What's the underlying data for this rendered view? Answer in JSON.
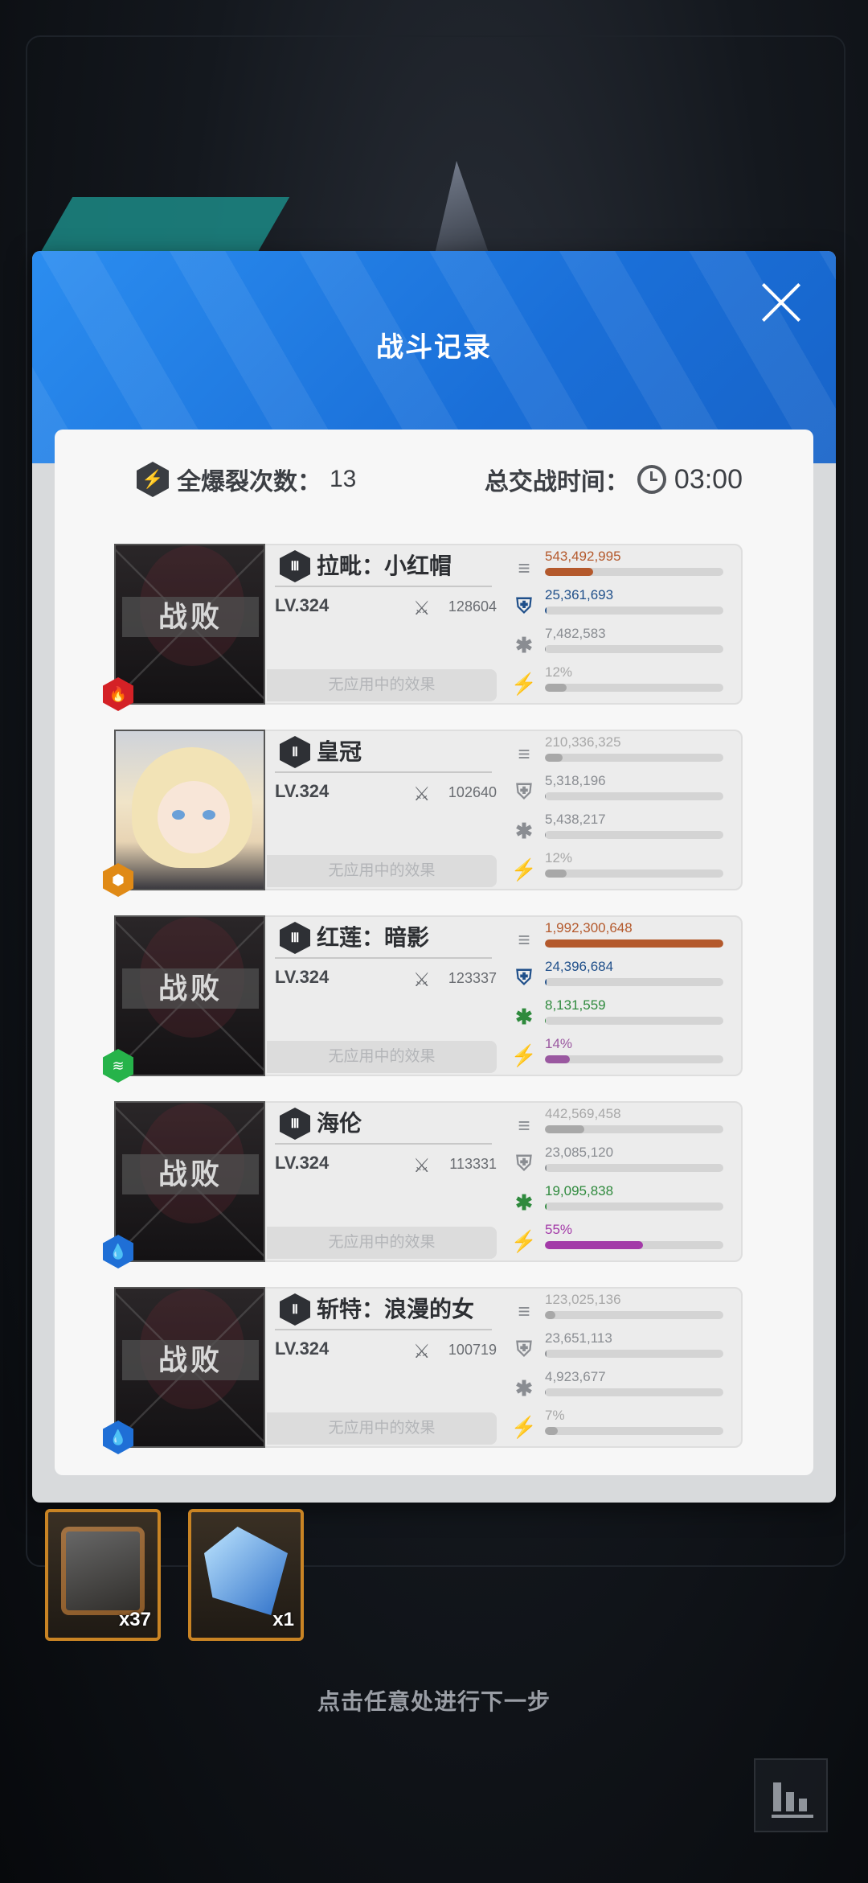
{
  "dialog": {
    "title": "战斗记录",
    "summary": {
      "burst_label": "全爆裂次数：",
      "burst_count": "13",
      "time_label": "总交战时间：",
      "time_value": "03:00"
    }
  },
  "rows": [
    {
      "rank": "Ⅲ",
      "name": "拉毗：小红帽",
      "level": "LV.324",
      "power": "128604",
      "status": "战败",
      "element": "fire-icon",
      "effect": "无应用中的效果",
      "stats": [
        {
          "value": "543,492,995",
          "fraction": 0.27,
          "color": "#b4592c"
        },
        {
          "value": "25,361,693",
          "fraction": 0.01,
          "color": "#1f4f8a"
        },
        {
          "value": "7,482,583",
          "fraction": 0.0,
          "color": "#8a8d92"
        },
        {
          "value": "12%",
          "fraction": 0.12,
          "color": "#a8a8a8"
        }
      ]
    },
    {
      "rank": "Ⅱ",
      "name": "皇冠",
      "level": "LV.324",
      "power": "102640",
      "status": "",
      "element": "iron-icon",
      "effect": "无应用中的效果",
      "stats": [
        {
          "value": "210,336,325",
          "fraction": 0.1,
          "color": "#a8a8a8"
        },
        {
          "value": "5,318,196",
          "fraction": 0.0,
          "color": "#8a8d92"
        },
        {
          "value": "5,438,217",
          "fraction": 0.0,
          "color": "#8a8d92"
        },
        {
          "value": "12%",
          "fraction": 0.12,
          "color": "#a8a8a8"
        }
      ]
    },
    {
      "rank": "Ⅲ",
      "name": "红莲：暗影",
      "level": "LV.324",
      "power": "123337",
      "status": "战败",
      "element": "wind-icon",
      "effect": "无应用中的效果",
      "stats": [
        {
          "value": "1,992,300,648",
          "fraction": 1.0,
          "color": "#b4592c"
        },
        {
          "value": "24,396,684",
          "fraction": 0.01,
          "color": "#1f4f8a"
        },
        {
          "value": "8,131,559",
          "fraction": 0.0,
          "color": "#2f8a3d"
        },
        {
          "value": "14%",
          "fraction": 0.14,
          "color": "#9a58a0"
        }
      ]
    },
    {
      "rank": "Ⅲ",
      "name": "海伦",
      "level": "LV.324",
      "power": "113331",
      "status": "战败",
      "element": "water-icon",
      "effect": "无应用中的效果",
      "stats": [
        {
          "value": "442,569,458",
          "fraction": 0.22,
          "color": "#a8a8a8"
        },
        {
          "value": "23,085,120",
          "fraction": 0.01,
          "color": "#8a8d92"
        },
        {
          "value": "19,095,838",
          "fraction": 0.01,
          "color": "#2f8a3d"
        },
        {
          "value": "55%",
          "fraction": 0.55,
          "color": "#a33aa8"
        }
      ]
    },
    {
      "rank": "Ⅱ",
      "name": "斩特：浪漫的女",
      "level": "LV.324",
      "power": "100719",
      "status": "战败",
      "element": "water-icon",
      "effect": "无应用中的效果",
      "stats": [
        {
          "value": "123,025,136",
          "fraction": 0.06,
          "color": "#a8a8a8"
        },
        {
          "value": "23,651,113",
          "fraction": 0.01,
          "color": "#8a8d92"
        },
        {
          "value": "4,923,677",
          "fraction": 0.0,
          "color": "#8a8d92"
        },
        {
          "value": "7%",
          "fraction": 0.07,
          "color": "#a8a8a8"
        }
      ]
    }
  ],
  "rewards": [
    {
      "icon": "supply-box-icon",
      "count": "x37"
    },
    {
      "icon": "crystal-icon",
      "count": "x1"
    }
  ],
  "hint": "点击任意处进行下一步"
}
